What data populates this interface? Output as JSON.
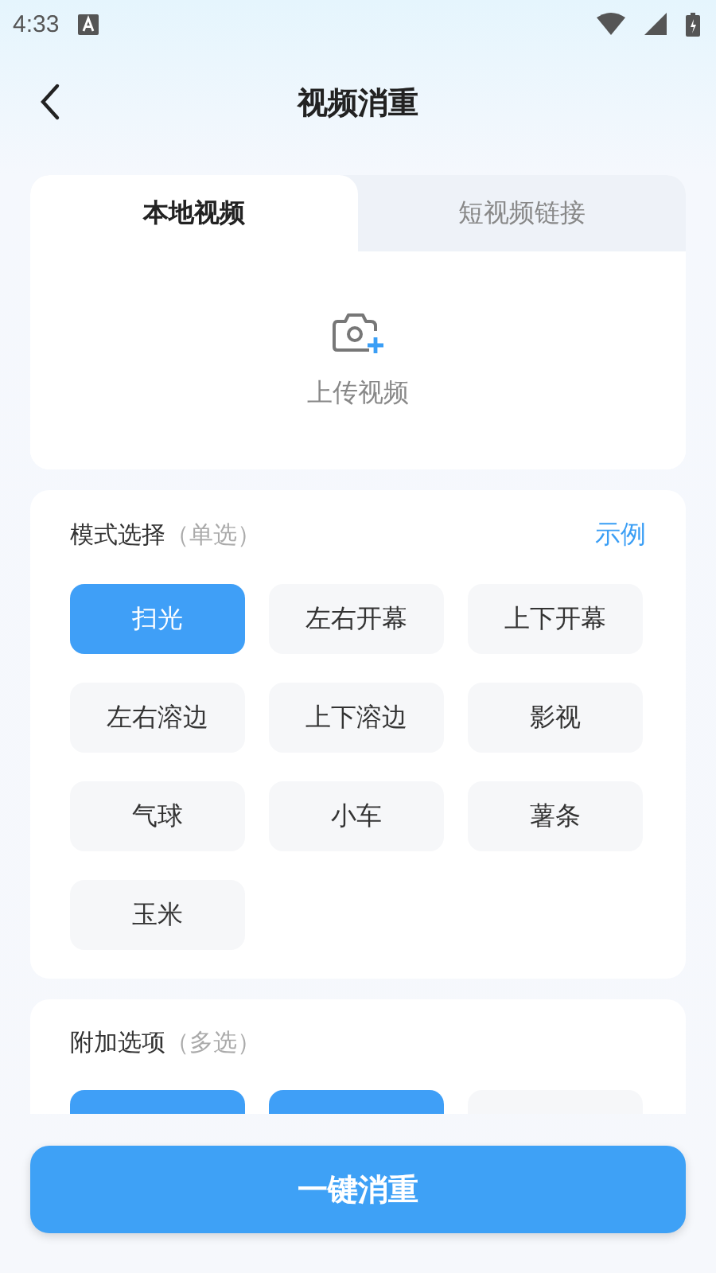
{
  "status_bar": {
    "time": "4:33"
  },
  "header": {
    "title": "视频消重"
  },
  "source_tabs": [
    {
      "label": "本地视频",
      "selected": true
    },
    {
      "label": "短视频链接",
      "selected": false
    }
  ],
  "upload": {
    "label": "上传视频"
  },
  "mode_section": {
    "title": "模式选择",
    "hint": "（单选）",
    "link": "示例",
    "options": [
      {
        "label": "扫光",
        "selected": true
      },
      {
        "label": "左右开幕",
        "selected": false
      },
      {
        "label": "上下开幕",
        "selected": false
      },
      {
        "label": "左右溶边",
        "selected": false
      },
      {
        "label": "上下溶边",
        "selected": false
      },
      {
        "label": "影视",
        "selected": false
      },
      {
        "label": "气球",
        "selected": false
      },
      {
        "label": "小车",
        "selected": false
      },
      {
        "label": "薯条",
        "selected": false
      },
      {
        "label": "玉米",
        "selected": false
      }
    ]
  },
  "extra_section": {
    "title": "附加选项",
    "hint": "（多选）",
    "options": [
      {
        "selected": true
      },
      {
        "selected": true
      },
      {
        "selected": false
      }
    ]
  },
  "action_button": {
    "label": "一键消重"
  }
}
